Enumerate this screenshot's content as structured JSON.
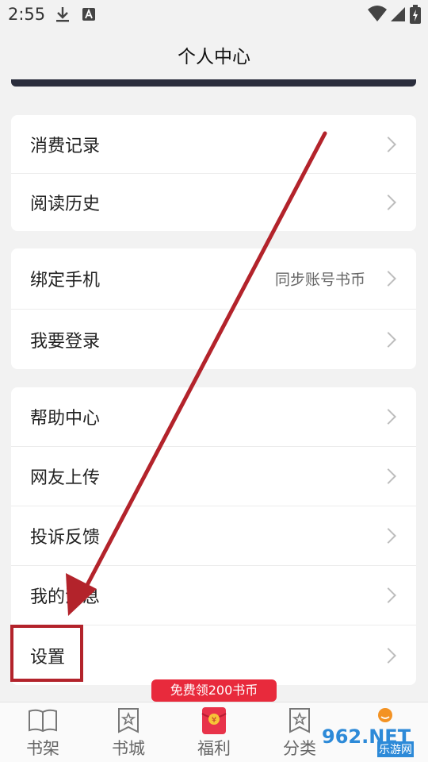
{
  "status_bar": {
    "time": "2:55"
  },
  "header": {
    "title": "个人中心"
  },
  "groups": [
    {
      "items": [
        {
          "label": "消费记录",
          "hint": ""
        },
        {
          "label": "阅读历史",
          "hint": ""
        }
      ]
    },
    {
      "items": [
        {
          "label": "绑定手机",
          "hint": "同步账号书币"
        },
        {
          "label": "我要登录",
          "hint": ""
        }
      ]
    },
    {
      "items": [
        {
          "label": "帮助中心",
          "hint": ""
        },
        {
          "label": "网友上传",
          "hint": ""
        },
        {
          "label": "投诉反馈",
          "hint": ""
        },
        {
          "label": "我的消息",
          "hint": ""
        },
        {
          "label": "设置",
          "hint": ""
        }
      ]
    }
  ],
  "promo": {
    "label": "免费领200书币"
  },
  "tab_bar": {
    "tabs": [
      {
        "label": "书架",
        "icon": "book-icon"
      },
      {
        "label": "书城",
        "icon": "star-book-icon"
      },
      {
        "label": "福利",
        "icon": "red-envelope-icon"
      },
      {
        "label": "分类",
        "icon": "category-icon"
      },
      {
        "label": "",
        "icon": "profile-icon"
      }
    ]
  },
  "watermark": {
    "text": "962.NET",
    "subtext": "乐游网"
  },
  "colors": {
    "accent": "#e82a3c",
    "annotation": "#b3232b",
    "dark_strip": "#2b2e3d"
  }
}
